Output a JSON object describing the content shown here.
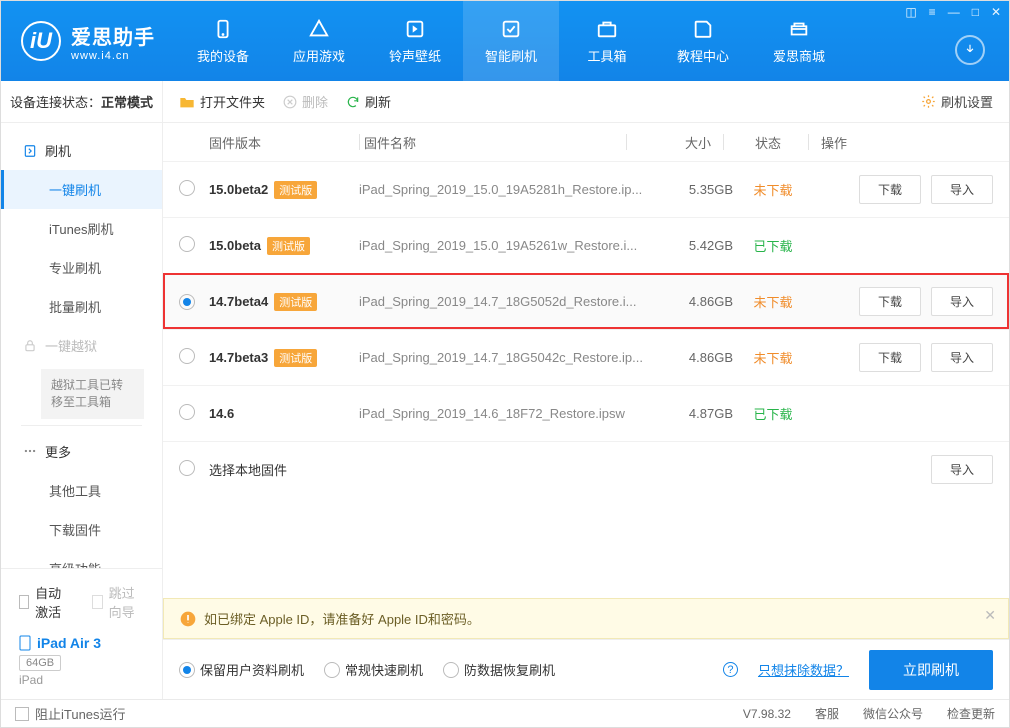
{
  "brand": {
    "name": "爱思助手",
    "url": "www.i4.cn"
  },
  "nav": [
    {
      "label": "我的设备"
    },
    {
      "label": "应用游戏"
    },
    {
      "label": "铃声壁纸"
    },
    {
      "label": "智能刷机"
    },
    {
      "label": "工具箱"
    },
    {
      "label": "教程中心"
    },
    {
      "label": "爱思商城"
    }
  ],
  "side": {
    "status_label": "设备连接状态：",
    "status_value": "正常模式",
    "flash": "刷机",
    "flash_items": [
      "一键刷机",
      "iTunes刷机",
      "专业刷机",
      "批量刷机"
    ],
    "jailbreak": "一键越狱",
    "jailbreak_note": "越狱工具已转移至工具箱",
    "more": "更多",
    "more_items": [
      "其他工具",
      "下载固件",
      "高级功能"
    ],
    "auto_activate": "自动激活",
    "skip_guide": "跳过向导",
    "device_name": "iPad Air 3",
    "device_storage": "64GB",
    "device_type": "iPad",
    "block_itunes": "阻止iTunes运行"
  },
  "toolbar": {
    "open": "打开文件夹",
    "delete": "删除",
    "refresh": "刷新",
    "settings": "刷机设置"
  },
  "table": {
    "headers": {
      "version": "固件版本",
      "name": "固件名称",
      "size": "大小",
      "status": "状态",
      "ops": "操作"
    },
    "btn_download": "下载",
    "btn_import": "导入",
    "rows": [
      {
        "ver": "15.0beta2",
        "beta": true,
        "name": "iPad_Spring_2019_15.0_19A5281h_Restore.ip...",
        "size": "5.35GB",
        "status": "未下载",
        "selected": false,
        "ops": true
      },
      {
        "ver": "15.0beta",
        "beta": true,
        "name": "iPad_Spring_2019_15.0_19A5261w_Restore.i...",
        "size": "5.42GB",
        "status": "已下载",
        "selected": false,
        "ops": false
      },
      {
        "ver": "14.7beta4",
        "beta": true,
        "name": "iPad_Spring_2019_14.7_18G5052d_Restore.i...",
        "size": "4.86GB",
        "status": "未下载",
        "selected": true,
        "ops": true
      },
      {
        "ver": "14.7beta3",
        "beta": true,
        "name": "iPad_Spring_2019_14.7_18G5042c_Restore.ip...",
        "size": "4.86GB",
        "status": "未下载",
        "selected": false,
        "ops": true
      },
      {
        "ver": "14.6",
        "beta": false,
        "name": "iPad_Spring_2019_14.6_18F72_Restore.ipsw",
        "size": "4.87GB",
        "status": "已下载",
        "selected": false,
        "ops": false
      }
    ],
    "local_firmware": "选择本地固件",
    "beta_badge": "测试版"
  },
  "tip": "如已绑定 Apple ID，请准备好 Apple ID和密码。",
  "actions": {
    "opts": [
      "保留用户资料刷机",
      "常规快速刷机",
      "防数据恢复刷机"
    ],
    "help_icon": "?",
    "erase_link": "只想抹除数据？",
    "flash_now": "立即刷机"
  },
  "status_bar": {
    "version": "V7.98.32",
    "items": [
      "客服",
      "微信公众号",
      "检查更新"
    ]
  },
  "status_colors": {
    "未下载": "st-no",
    "已下载": "st-yes"
  }
}
